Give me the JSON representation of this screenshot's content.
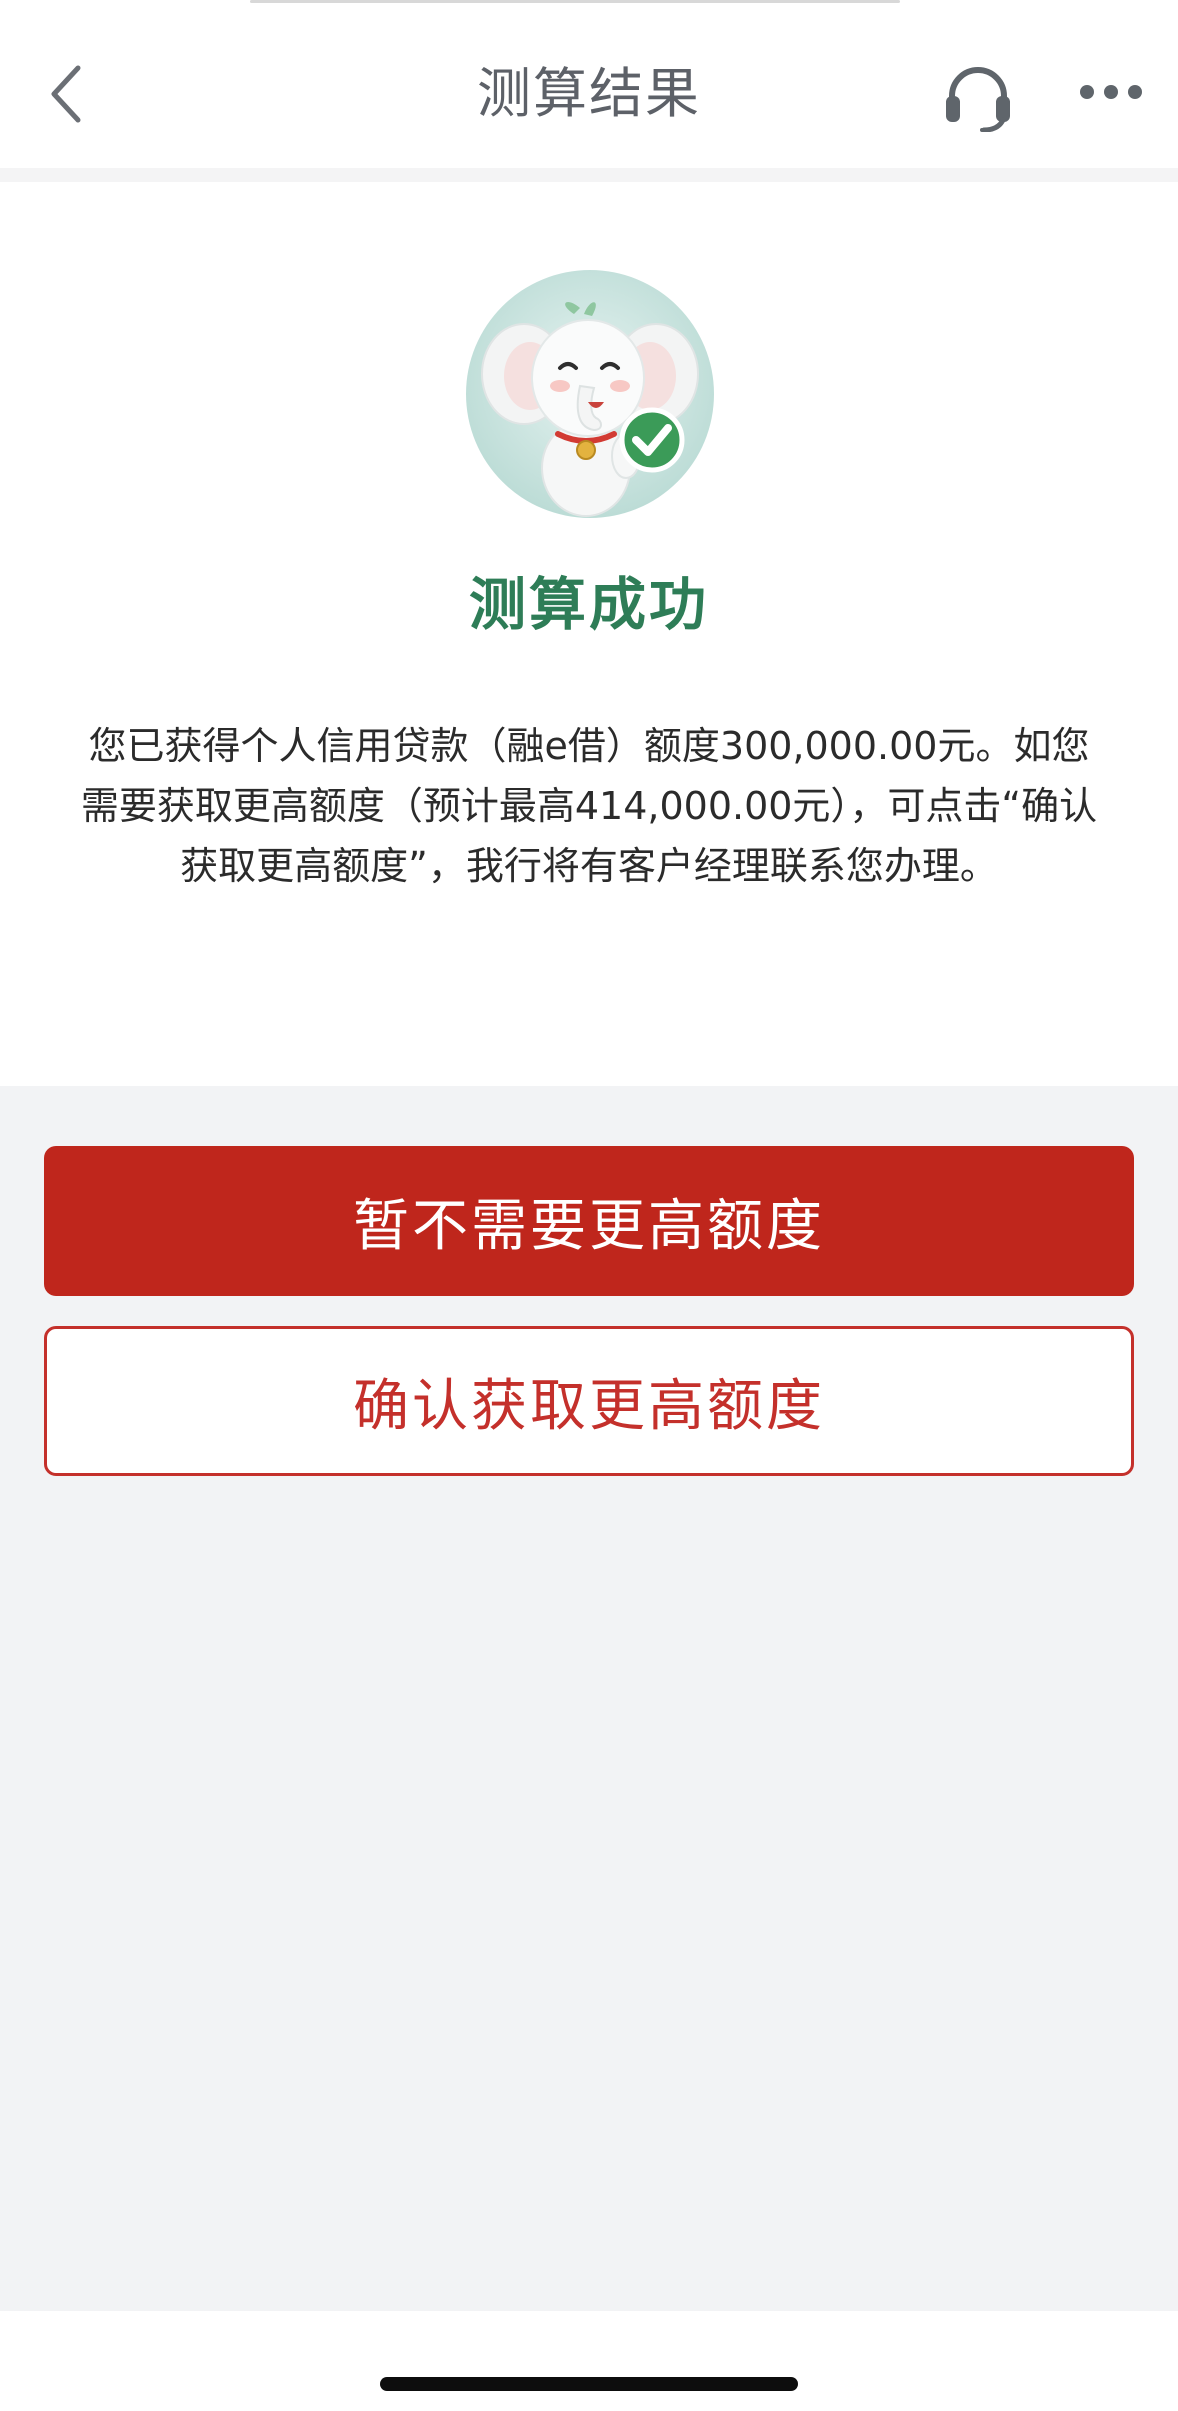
{
  "header": {
    "title": "测算结果",
    "back_icon": "chevron-left-icon",
    "service_icon": "headset-icon",
    "more_icon": "more-dots-icon"
  },
  "result": {
    "mascot_icon": "elephant-mascot-check-icon",
    "title": "测算成功",
    "description": "您已获得个人信用贷款（融e借）额度300,000.00元。如您需要获取更高额度（预计最高414,000.00元），可点击“确认获取更高额度”，我行将有客户经理联系您办理。"
  },
  "actions": {
    "decline_label": "暂不需要更高额度",
    "confirm_label": "确认获取更高额度"
  },
  "colors": {
    "accent_red": "#bf261c",
    "success_green": "#2e7d57",
    "text_dark": "#2b2b2b",
    "page_bg": "#f2f3f5"
  }
}
